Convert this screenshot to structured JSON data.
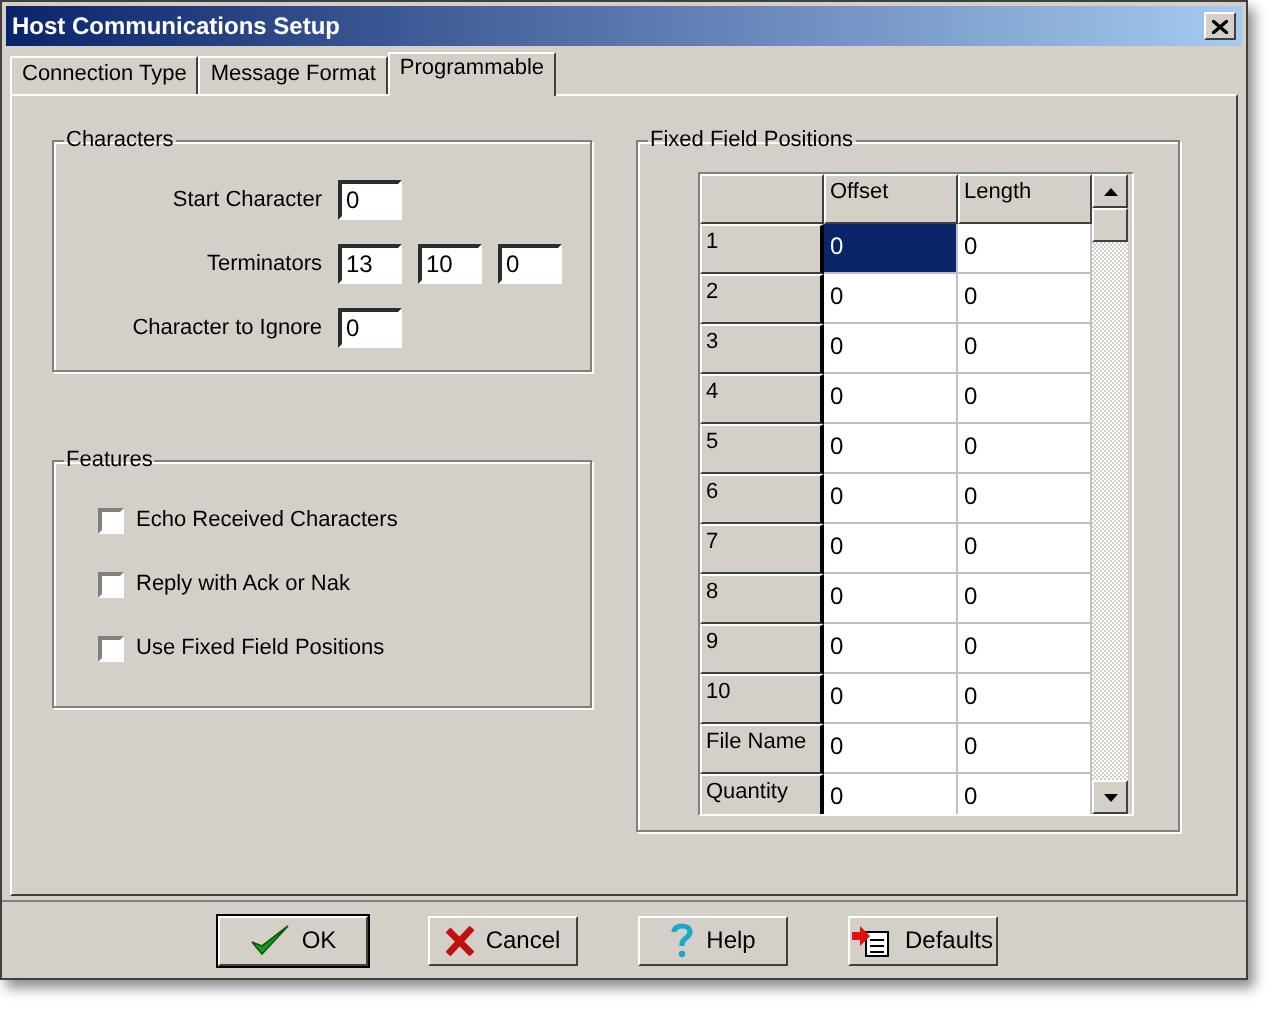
{
  "window": {
    "title": "Host Communications Setup"
  },
  "tabs": [
    {
      "label": "Connection Type",
      "selected": false
    },
    {
      "label": "Message Format",
      "selected": false
    },
    {
      "label": "Programmable",
      "selected": true
    }
  ],
  "characters": {
    "title": "Characters",
    "start_character": {
      "label": "Start Character",
      "value": "0"
    },
    "terminators": {
      "label": "Terminators",
      "values": [
        "13",
        "10",
        "0"
      ]
    },
    "ignore": {
      "label": "Character to Ignore",
      "value": "0"
    }
  },
  "features": {
    "title": "Features",
    "options": [
      {
        "label": "Echo Received Characters",
        "checked": false
      },
      {
        "label": "Reply with Ack or Nak",
        "checked": false
      },
      {
        "label": "Use Fixed Field Positions",
        "checked": false
      }
    ]
  },
  "fixed_fields": {
    "title": "Fixed Field Positions",
    "columns": [
      "Offset",
      "Length"
    ],
    "rows": [
      {
        "name": "1",
        "cells": [
          {
            "value": "0",
            "selected": true
          },
          {
            "value": "0",
            "selected": false
          }
        ]
      },
      {
        "name": "2",
        "cells": [
          {
            "value": "0",
            "selected": false
          },
          {
            "value": "0",
            "selected": false
          }
        ]
      },
      {
        "name": "3",
        "cells": [
          {
            "value": "0",
            "selected": false
          },
          {
            "value": "0",
            "selected": false
          }
        ]
      },
      {
        "name": "4",
        "cells": [
          {
            "value": "0",
            "selected": false
          },
          {
            "value": "0",
            "selected": false
          }
        ]
      },
      {
        "name": "5",
        "cells": [
          {
            "value": "0",
            "selected": false
          },
          {
            "value": "0",
            "selected": false
          }
        ]
      },
      {
        "name": "6",
        "cells": [
          {
            "value": "0",
            "selected": false
          },
          {
            "value": "0",
            "selected": false
          }
        ]
      },
      {
        "name": "7",
        "cells": [
          {
            "value": "0",
            "selected": false
          },
          {
            "value": "0",
            "selected": false
          }
        ]
      },
      {
        "name": "8",
        "cells": [
          {
            "value": "0",
            "selected": false
          },
          {
            "value": "0",
            "selected": false
          }
        ]
      },
      {
        "name": "9",
        "cells": [
          {
            "value": "0",
            "selected": false
          },
          {
            "value": "0",
            "selected": false
          }
        ]
      },
      {
        "name": "10",
        "cells": [
          {
            "value": "0",
            "selected": false
          },
          {
            "value": "0",
            "selected": false
          }
        ]
      },
      {
        "name": "File Name",
        "cells": [
          {
            "value": "0",
            "selected": false
          },
          {
            "value": "0",
            "selected": false
          }
        ]
      },
      {
        "name": "Quantity",
        "cells": [
          {
            "value": "0",
            "selected": false
          },
          {
            "value": "0",
            "selected": false
          }
        ]
      }
    ]
  },
  "buttons": [
    {
      "label": "OK",
      "kind": "ok",
      "default": true
    },
    {
      "label": "Cancel",
      "kind": "cancel",
      "default": false
    },
    {
      "label": "Help",
      "kind": "help",
      "default": false
    },
    {
      "label": "Defaults",
      "kind": "defaults",
      "default": false
    }
  ]
}
